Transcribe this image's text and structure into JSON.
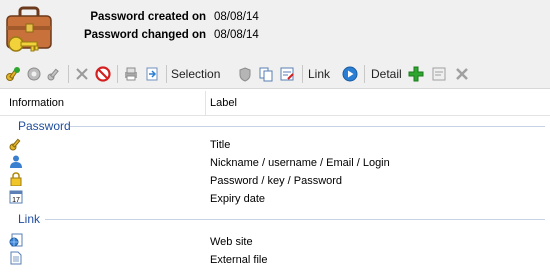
{
  "header": {
    "created_label": "Password created on",
    "created_value": "08/08/14",
    "changed_label": "Password changed on",
    "changed_value": "08/08/14",
    "icon": "briefcase-key-icon"
  },
  "toolbar": {
    "selection_label": "Selection",
    "link_label": "Link",
    "detail_label": "Detail"
  },
  "columns": {
    "information": "Information",
    "label": "Label"
  },
  "groups": {
    "password": {
      "title": "Password",
      "rows": [
        {
          "icon": "key-icon",
          "label": "Title"
        },
        {
          "icon": "user-icon",
          "label": "Nickname / username / Email / Login"
        },
        {
          "icon": "padlock-icon",
          "label": "Password / key / Password"
        },
        {
          "icon": "calendar-icon",
          "label": "Expiry date"
        }
      ]
    },
    "link": {
      "title": "Link",
      "rows": [
        {
          "icon": "web-page-icon",
          "label": "Web site"
        },
        {
          "icon": "document-icon",
          "label": "External file"
        }
      ]
    }
  },
  "colors": {
    "group_text": "#1f4e9e",
    "add_green": "#2fa62f",
    "delete_red": "#d42020",
    "play_blue": "#2a7fd4"
  }
}
